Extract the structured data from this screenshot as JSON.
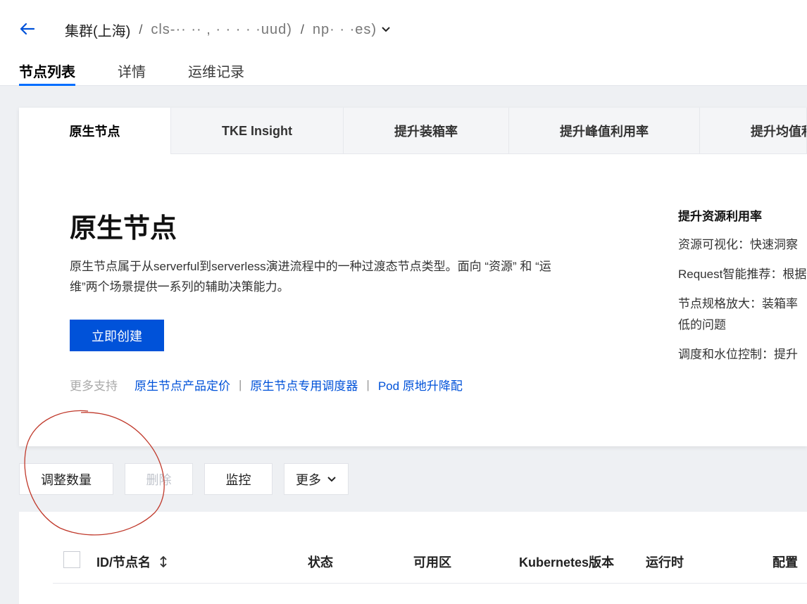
{
  "header": {
    "breadcrumb": {
      "cluster_label": "集群(上海)",
      "separator": "/",
      "cluster_id_masked": "cls-·· ·· ,        ·  · ·  ·  ·uud)",
      "nodepool_masked": "np· ·                          ·es)"
    },
    "tabs": [
      {
        "label": "节点列表",
        "active": true
      },
      {
        "label": "详情",
        "active": false
      },
      {
        "label": "运维记录",
        "active": false
      }
    ]
  },
  "feature": {
    "tabs": [
      {
        "label": "原生节点",
        "active": true
      },
      {
        "label": "TKE Insight",
        "active": false
      },
      {
        "label": "提升装箱率",
        "active": false
      },
      {
        "label": "提升峰值利用率",
        "active": false
      },
      {
        "label": "提升均值利",
        "active": false
      }
    ],
    "title": "原生节点",
    "description": "原生节点属于从serverful到serverless演进流程中的一种过渡态节点类型。面向 “资源” 和 “运维”两个场景提供一系列的辅助决策能力。",
    "create_button": "立即创建",
    "more_support_label": "更多支持",
    "links": [
      "原生节点产品定价",
      "原生节点专用调度器",
      "Pod 原地升降配"
    ],
    "link_separator": "|",
    "side": {
      "title": "提升资源利用率",
      "items": [
        "资源可视化：快速洞察",
        "Request智能推荐：根据",
        "节点规格放大：装箱率",
        "低的问题",
        "调度和水位控制：提升"
      ]
    }
  },
  "actions": {
    "adjust": "调整数量",
    "delete": "删除",
    "monitor": "监控",
    "more": "更多"
  },
  "table": {
    "columns": [
      "ID/节点名",
      "状态",
      "可用区",
      "Kubernetes版本",
      "运行时",
      "配置"
    ]
  },
  "colors": {
    "accent": "#006eff",
    "primary_button": "#0052d9",
    "link": "#0052d9",
    "annotation": "#c0392b"
  }
}
